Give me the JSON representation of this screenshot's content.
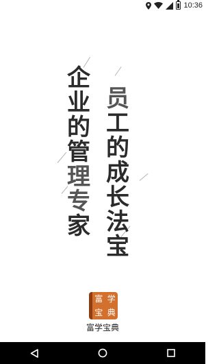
{
  "status_bar": {
    "time": "10:36"
  },
  "splash": {
    "tagline_left": [
      "企",
      "业",
      "的",
      "管",
      "理",
      "专",
      "家"
    ],
    "tagline_right": [
      "员",
      "工",
      "的",
      "成",
      "长",
      "法",
      "宝"
    ]
  },
  "app": {
    "icon_chars": [
      "富",
      "学",
      "宝",
      "典"
    ],
    "name": "富学宝典",
    "icon_color": "#d3702e"
  },
  "nav": {
    "back": "back-icon",
    "home": "home-icon",
    "recents": "recents-icon"
  }
}
